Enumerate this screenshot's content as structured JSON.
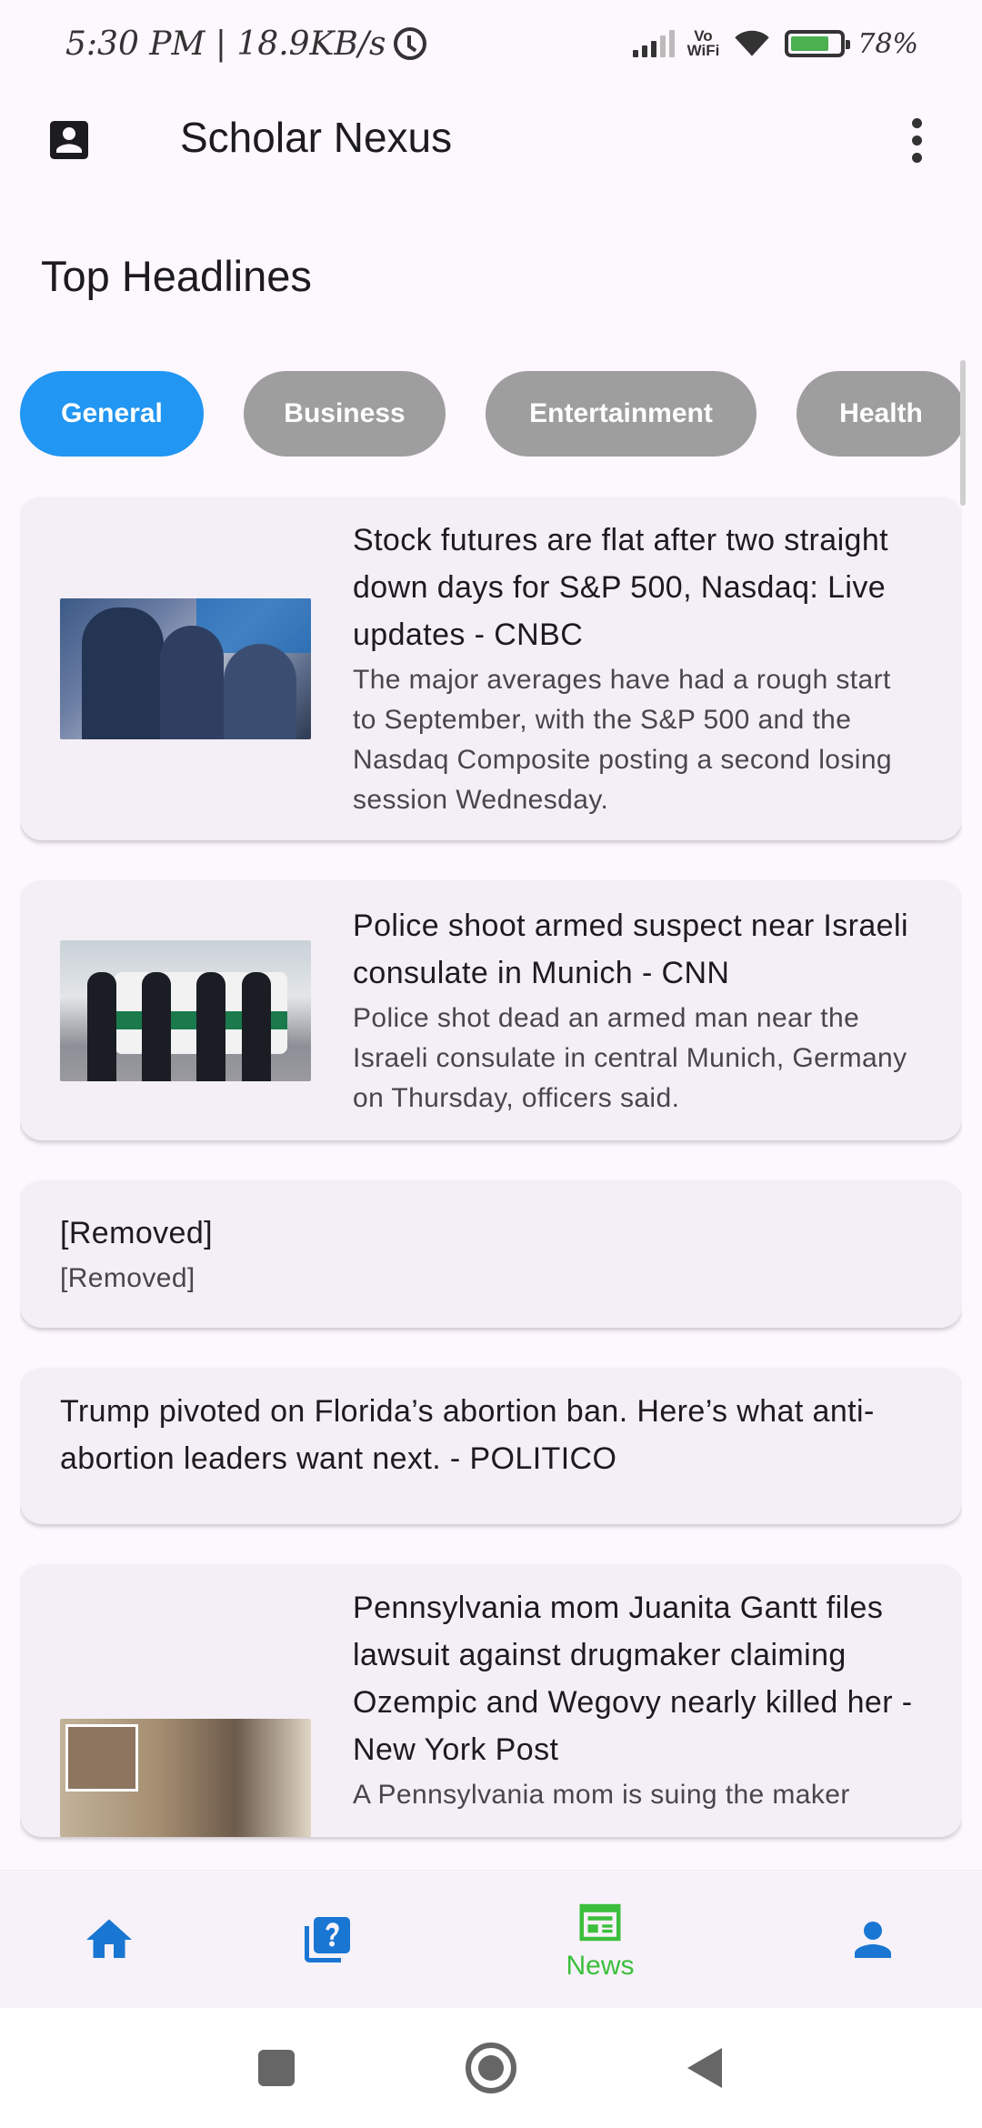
{
  "status_bar": {
    "time_speed": "5:30 PM | 18.9KB/s",
    "network_label": "Vo\nWiFi",
    "battery_percent": "78%",
    "battery_level": 0.78
  },
  "app_bar": {
    "title": "Scholar Nexus",
    "profile_icon": "account-box-icon",
    "menu_icon": "more-vert-icon"
  },
  "section_title": "Top Headlines",
  "categories": [
    {
      "label": "General",
      "active": true
    },
    {
      "label": "Business",
      "active": false
    },
    {
      "label": "Entertainment",
      "active": false
    },
    {
      "label": "Health",
      "active": false
    }
  ],
  "articles": [
    {
      "title": "Stock futures are flat after two straight down days for S&P 500, Nasdaq: Live updates - CNBC",
      "description": "The major averages have had a rough start to September, with the S&P 500 and the Nasdaq Composite posting a second losing session Wednesday."
    },
    {
      "title": "Police shoot armed suspect near Israeli consulate in Munich - CNN",
      "description": "Police shot dead an armed man near the Israeli consulate in central Munich, Germany on Thursday, officers said."
    },
    {
      "title": "[Removed]",
      "description": "[Removed]"
    },
    {
      "title": "Trump pivoted on Florida’s abortion ban. Here’s what anti-abortion leaders want next. - POLITICO",
      "description": ""
    },
    {
      "title": "Pennsylvania mom Juanita Gantt files lawsuit against drugmaker claiming Ozempic and Wegovy nearly killed her - New York Post",
      "description": "A Pennsylvania mom is suing the maker"
    }
  ],
  "bottom_nav": {
    "items": [
      {
        "icon": "home-icon",
        "label": ""
      },
      {
        "icon": "quiz-icon",
        "label": ""
      },
      {
        "icon": "newspaper-icon",
        "label": "News"
      },
      {
        "icon": "person-icon",
        "label": ""
      }
    ],
    "active_color": "#3bbf3b",
    "inactive_color": "#1976d2"
  },
  "theme": {
    "chip_active": "#2196f3",
    "chip_inactive": "#9e9e9e",
    "card_background": "#f4eff6",
    "page_background": "#fdf7fe"
  }
}
